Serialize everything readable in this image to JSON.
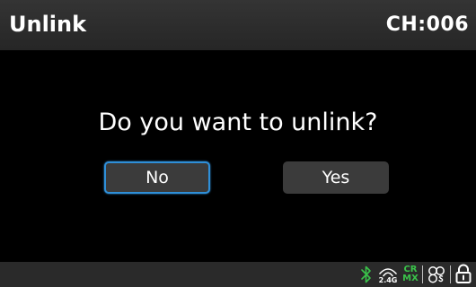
{
  "header": {
    "title": "Unlink",
    "channel": "CH:006"
  },
  "dialog": {
    "prompt": "Do you want to unlink?",
    "no_label": "No",
    "yes_label": "Yes",
    "selected": "No"
  },
  "status_bar": {
    "icons": [
      "bluetooth-icon",
      "wireless-2.4g-icon",
      "crmx-icon",
      "link-group-icon",
      "unlock-icon"
    ],
    "wireless_label": "2.4G",
    "crmx_top": "CR",
    "crmx_bottom": "MX"
  },
  "colors": {
    "background": "#000000",
    "bar": "#2a2a2a",
    "button": "#3b3b3b",
    "focus": "#2f8fd8",
    "bluetooth": "#3ac34a",
    "crmx": "#3ac34a"
  }
}
